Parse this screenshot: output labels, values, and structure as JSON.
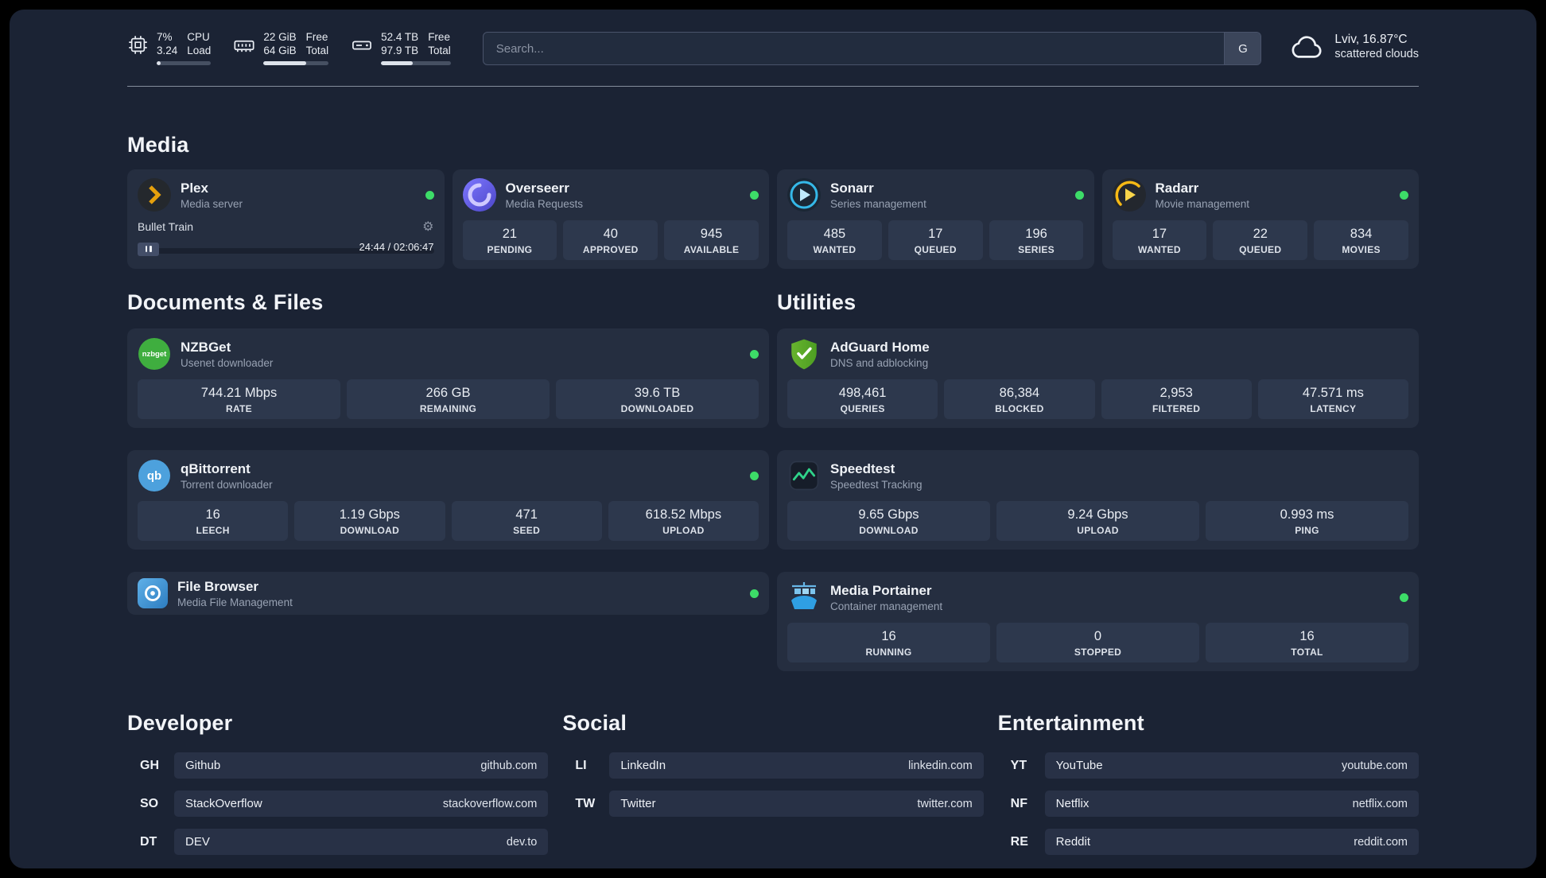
{
  "topbar": {
    "cpu": {
      "value_top": "7%",
      "value_bottom": "3.24",
      "label_top": "CPU",
      "label_bottom": "Load",
      "bar_percent": 7
    },
    "ram": {
      "value_top": "22 GiB",
      "value_bottom": "64 GiB",
      "label_top": "Free",
      "label_bottom": "Total",
      "bar_percent": 66
    },
    "disk": {
      "value_top": "52.4 TB",
      "value_bottom": "97.9 TB",
      "label_top": "Free",
      "label_bottom": "Total",
      "bar_percent": 46
    },
    "search": {
      "placeholder": "Search...",
      "provider_label": "G"
    },
    "weather": {
      "location": "Lviv, 16.87°C",
      "condition": "scattered clouds"
    }
  },
  "media": {
    "title": "Media",
    "plex": {
      "name": "Plex",
      "subtitle": "Media server",
      "now_playing": "Bullet Train",
      "time": "24:44 / 02:06:47",
      "progress_percent": 19
    },
    "overseerr": {
      "name": "Overseerr",
      "subtitle": "Media Requests",
      "stats": [
        {
          "value": "21",
          "label": "PENDING"
        },
        {
          "value": "40",
          "label": "APPROVED"
        },
        {
          "value": "945",
          "label": "AVAILABLE"
        }
      ]
    },
    "sonarr": {
      "name": "Sonarr",
      "subtitle": "Series management",
      "stats": [
        {
          "value": "485",
          "label": "WANTED"
        },
        {
          "value": "17",
          "label": "QUEUED"
        },
        {
          "value": "196",
          "label": "SERIES"
        }
      ]
    },
    "radarr": {
      "name": "Radarr",
      "subtitle": "Movie management",
      "stats": [
        {
          "value": "17",
          "label": "WANTED"
        },
        {
          "value": "22",
          "label": "QUEUED"
        },
        {
          "value": "834",
          "label": "MOVIES"
        }
      ]
    }
  },
  "documents": {
    "title": "Documents & Files",
    "nzbget": {
      "name": "NZBGet",
      "subtitle": "Usenet downloader",
      "icon_text": "nzbget",
      "stats": [
        {
          "value": "744.21 Mbps",
          "label": "RATE"
        },
        {
          "value": "266 GB",
          "label": "REMAINING"
        },
        {
          "value": "39.6 TB",
          "label": "DOWNLOADED"
        }
      ]
    },
    "qbittorrent": {
      "name": "qBittorrent",
      "subtitle": "Torrent downloader",
      "icon_text": "qb",
      "stats": [
        {
          "value": "16",
          "label": "LEECH"
        },
        {
          "value": "1.19 Gbps",
          "label": "DOWNLOAD"
        },
        {
          "value": "471",
          "label": "SEED"
        },
        {
          "value": "618.52 Mbps",
          "label": "UPLOAD"
        }
      ]
    },
    "filebrowser": {
      "name": "File Browser",
      "subtitle": "Media File Management"
    }
  },
  "utilities": {
    "title": "Utilities",
    "adguard": {
      "name": "AdGuard Home",
      "subtitle": "DNS and adblocking",
      "stats": [
        {
          "value": "498,461",
          "label": "QUERIES"
        },
        {
          "value": "86,384",
          "label": "BLOCKED"
        },
        {
          "value": "2,953",
          "label": "FILTERED"
        },
        {
          "value": "47.571 ms",
          "label": "LATENCY"
        }
      ]
    },
    "speedtest": {
      "name": "Speedtest",
      "subtitle": "Speedtest Tracking",
      "stats": [
        {
          "value": "9.65 Gbps",
          "label": "DOWNLOAD"
        },
        {
          "value": "9.24 Gbps",
          "label": "UPLOAD"
        },
        {
          "value": "0.993 ms",
          "label": "PING"
        }
      ]
    },
    "portainer": {
      "name": "Media Portainer",
      "subtitle": "Container management",
      "stats": [
        {
          "value": "16",
          "label": "RUNNING"
        },
        {
          "value": "0",
          "label": "STOPPED"
        },
        {
          "value": "16",
          "label": "TOTAL"
        }
      ]
    }
  },
  "bookmarks": [
    {
      "title": "Developer",
      "items": [
        {
          "abbr": "GH",
          "name": "Github",
          "url": "github.com"
        },
        {
          "abbr": "SO",
          "name": "StackOverflow",
          "url": "stackoverflow.com"
        },
        {
          "abbr": "DT",
          "name": "DEV",
          "url": "dev.to"
        }
      ]
    },
    {
      "title": "Social",
      "items": [
        {
          "abbr": "LI",
          "name": "LinkedIn",
          "url": "linkedin.com"
        },
        {
          "abbr": "TW",
          "name": "Twitter",
          "url": "twitter.com"
        }
      ]
    },
    {
      "title": "Entertainment",
      "items": [
        {
          "abbr": "YT",
          "name": "YouTube",
          "url": "youtube.com"
        },
        {
          "abbr": "NF",
          "name": "Netflix",
          "url": "netflix.com"
        },
        {
          "abbr": "RE",
          "name": "Reddit",
          "url": "reddit.com"
        }
      ]
    }
  ],
  "colors": {
    "status_online": "#3ddc68",
    "plex_accent": "#e5a00d"
  }
}
